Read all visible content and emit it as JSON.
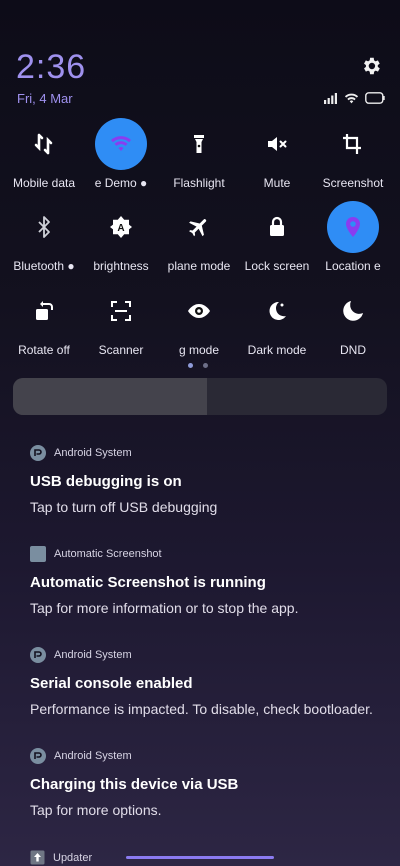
{
  "header": {
    "time": "2:36",
    "date": "Fri, 4 Mar"
  },
  "tiles": [
    {
      "label": "Mobile data",
      "icon": "mobile-data-icon",
      "active": false
    },
    {
      "label": "e   Demo ●",
      "icon": "wifi-icon",
      "active": true
    },
    {
      "label": "Flashlight",
      "icon": "flashlight-icon",
      "active": false
    },
    {
      "label": "Mute",
      "icon": "mute-icon",
      "active": false
    },
    {
      "label": "Screenshot",
      "icon": "crop-icon",
      "active": false
    },
    {
      "label": "Bluetooth ●",
      "icon": "bluetooth-icon",
      "active": false
    },
    {
      "label": "brightness",
      "icon": "auto-brightness-icon",
      "active": false
    },
    {
      "label": "plane mode",
      "icon": "airplane-icon",
      "active": false
    },
    {
      "label": "Lock screen",
      "icon": "lock-icon",
      "active": false
    },
    {
      "label": "Location  e",
      "icon": "location-icon",
      "active": true
    },
    {
      "label": "Rotate off",
      "icon": "rotate-icon",
      "active": false
    },
    {
      "label": "Scanner",
      "icon": "scanner-icon",
      "active": false
    },
    {
      "label": "g mode",
      "icon": "eye-icon",
      "active": false
    },
    {
      "label": "Dark mode",
      "icon": "dark-mode-icon",
      "active": false
    },
    {
      "label": "DND",
      "icon": "moon-icon",
      "active": false
    }
  ],
  "pager": {
    "pages": 2,
    "current": 1
  },
  "brightness": {
    "level": 0.52
  },
  "notifications": [
    {
      "app": "Android System",
      "title": "USB debugging is on",
      "text": "Tap to turn off USB debugging",
      "icon": "android-system-icon"
    },
    {
      "app": "Automatic Screenshot",
      "title": "Automatic Screenshot is running",
      "text": "Tap for more information or to stop the app.",
      "icon": "app-square-icon"
    },
    {
      "app": "Android System",
      "title": "Serial console enabled",
      "text": "Performance is impacted. To disable, check bootloader.",
      "icon": "android-system-icon"
    },
    {
      "app": "Android System",
      "title": "Charging this device via USB",
      "text": "Tap for more options.",
      "icon": "android-system-icon"
    }
  ],
  "bottom": {
    "app": "Updater"
  },
  "colors": {
    "accent": "#9f91ee",
    "tile_active": "#2f8df5"
  }
}
